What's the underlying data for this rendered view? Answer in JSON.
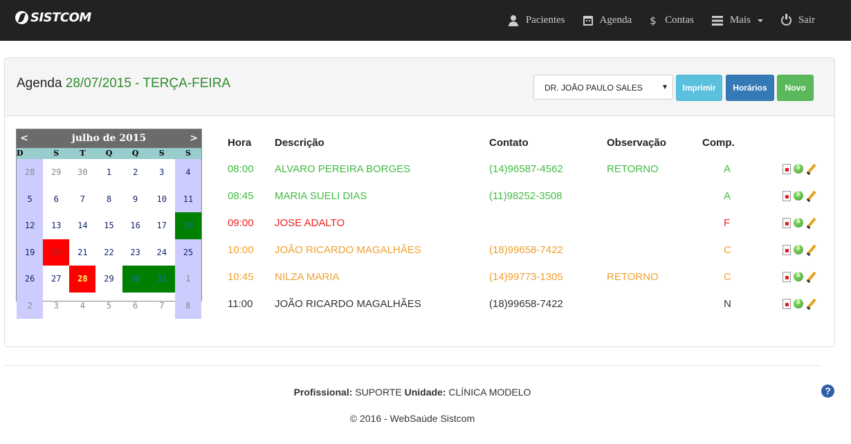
{
  "brand": {
    "name": "SISTCOM"
  },
  "nav": {
    "items": [
      {
        "label": "Pacientes",
        "icon": "user-icon"
      },
      {
        "label": "Agenda",
        "icon": "calendar-icon"
      },
      {
        "label": "Contas",
        "icon": "dollar-icon"
      },
      {
        "label": "Mais",
        "icon": "list-icon"
      },
      {
        "label": "Sair",
        "icon": "power-icon"
      }
    ]
  },
  "header": {
    "title": "Agenda",
    "date": "28/07/2015 - TERÇA-FEIRA",
    "doctor_select": "DR. JOÃO PAULO SALES",
    "print_label": "Imprimir",
    "hours_label": "Horários",
    "new_label": "Novo"
  },
  "calendar": {
    "prev": "<",
    "next": ">",
    "month": "julho de 2015",
    "weekdays": [
      "D",
      "S",
      "T",
      "Q",
      "Q",
      "S",
      "S"
    ],
    "weeks": [
      [
        "28",
        "29",
        "30",
        "1",
        "2",
        "3",
        "4"
      ],
      [
        "5",
        "6",
        "7",
        "8",
        "9",
        "10",
        "11"
      ],
      [
        "12",
        "13",
        "14",
        "15",
        "16",
        "17",
        "18"
      ],
      [
        "19",
        "20",
        "21",
        "22",
        "23",
        "24",
        "25"
      ],
      [
        "26",
        "27",
        "28",
        "29",
        "30",
        "31",
        "1"
      ],
      [
        "2",
        "3",
        "4",
        "5",
        "6",
        "7",
        "8"
      ]
    ]
  },
  "table": {
    "headers": {
      "hora": "Hora",
      "descricao": "Descrição",
      "contato": "Contato",
      "observacao": "Observação",
      "comp": "Comp."
    },
    "rows": [
      {
        "hora": "08:00",
        "descricao": "ALVARO PEREIRA BORGES",
        "contato": "(14)96587-4562",
        "observacao": "RETORNO",
        "comp": "A"
      },
      {
        "hora": "08:45",
        "descricao": "MARIA SUELI DIAS",
        "contato": "(11)98252-3508",
        "observacao": "",
        "comp": "A"
      },
      {
        "hora": "09:00",
        "descricao": "JOSE ADALTO",
        "contato": "",
        "observacao": "",
        "comp": "F"
      },
      {
        "hora": "10:00",
        "descricao": "JOÃO RICARDO MAGALHÃES",
        "contato": "(18)99658-7422",
        "observacao": "",
        "comp": "C"
      },
      {
        "hora": "10:45",
        "descricao": "NILZA MARIA",
        "contato": "(14)99773-1305",
        "observacao": "RETORNO",
        "comp": "C"
      },
      {
        "hora": "11:00",
        "descricao": "JOÃO RICARDO MAGALHÃES",
        "contato": "(18)99658-7422",
        "observacao": "",
        "comp": "N"
      }
    ]
  },
  "footer": {
    "prof_label": "Profissional:",
    "prof_value": "SUPORTE",
    "unit_label": "Unidade:",
    "unit_value": "CLÍNICA MODELO",
    "copyright": "© 2016 - WebSaúde Sistcom",
    "help": "?"
  },
  "colors": {
    "navbar": "#222222",
    "date_green": "#2e8b2e",
    "status_A": "#44bb44",
    "status_F": "#ee2222",
    "status_C": "#f0a030",
    "status_N": "#333333"
  }
}
